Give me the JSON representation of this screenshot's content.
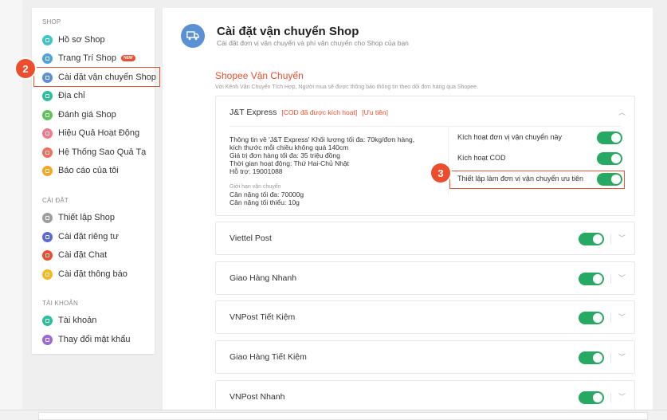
{
  "sidebar": {
    "shop_section": "SHOP",
    "shop_items": [
      {
        "label": "Hồ sơ Shop",
        "color": "#3fc4c8"
      },
      {
        "label": "Trang Trí Shop",
        "color": "#4aa3df",
        "badge": "NEW"
      },
      {
        "label": "Cài đặt vận chuyển Shop",
        "color": "#5b8fd6"
      },
      {
        "label": "Địa chỉ",
        "color": "#2bbf9e"
      },
      {
        "label": "Đánh giá Shop",
        "color": "#5fc458"
      },
      {
        "label": "Hiệu Quả Hoạt Động",
        "color": "#f47a8a"
      },
      {
        "label": "Hệ Thống Sao Quả Tạ",
        "color": "#f56c5a"
      },
      {
        "label": "Báo cáo của tôi",
        "color": "#f5a623"
      }
    ],
    "settings_section": "CÀI ĐẶT",
    "settings_items": [
      {
        "label": "Thiết lập Shop",
        "color": "#9e9e9e"
      },
      {
        "label": "Cài đặt riêng tư",
        "color": "#5b6bd6"
      },
      {
        "label": "Cài đặt Chat",
        "color": "#ee4d2d"
      },
      {
        "label": "Cài đặt thông báo",
        "color": "#f5b821"
      }
    ],
    "account_section": "TÀI KHOẢN",
    "account_items": [
      {
        "label": "Tài khoản",
        "color": "#2bbf9e"
      },
      {
        "label": "Thay đổi mật khẩu",
        "color": "#9b6ad6"
      }
    ]
  },
  "steps": {
    "step2": "2",
    "step3": "3"
  },
  "header": {
    "title": "Cài đặt vận chuyển Shop",
    "subtitle": "Cài đặt đơn vị vận chuyển và phí vận chuyển cho Shop của bạn"
  },
  "section": {
    "title": "Shopee Vận Chuyển",
    "description": "Với Kênh Vận Chuyển Tích Hợp, Người mua sẽ được thông báo thông tin theo dõi đơn hàng qua Shopee."
  },
  "jt": {
    "name": "J&T Express",
    "tag_cod": "[COD đã được kích hoạt]",
    "tag_priority": "[Ưu tiên]",
    "info_lines": [
      "Thông tin về 'J&T Express' Khối lượng tối đa: 70kg/đơn hàng,",
      "kích thước mỗi chiều không quá 140cm",
      "Giá trị đơn hàng tối đa: 35 triệu đồng",
      "Thời gian hoạt động: Thứ Hai-Chủ Nhật",
      "Hỗ trợ: 19001088"
    ],
    "limit_label": "Giới hạn vận chuyển",
    "limit_lines": [
      "Cân nặng tối đa: 70000g",
      "Cân nặng tối thiểu: 10g"
    ],
    "settings": [
      {
        "label": "Kích hoạt đơn vị vận chuyển này",
        "enabled": true
      },
      {
        "label": "Kích hoạt COD",
        "enabled": true
      },
      {
        "label": "Thiết lập làm đơn vị vận chuyển ưu tiên",
        "enabled": true
      }
    ]
  },
  "carriers": [
    {
      "name": "Viettel Post",
      "enabled": true
    },
    {
      "name": "Giao Hàng Nhanh",
      "enabled": true
    },
    {
      "name": "VNPost Tiết Kiệm",
      "enabled": true
    },
    {
      "name": "Giao Hàng Tiết Kiệm",
      "enabled": true
    },
    {
      "name": "VNPost Nhanh",
      "enabled": true
    }
  ],
  "colors": {
    "accent": "#ee4d2d",
    "toggle_on": "#26aa63"
  }
}
